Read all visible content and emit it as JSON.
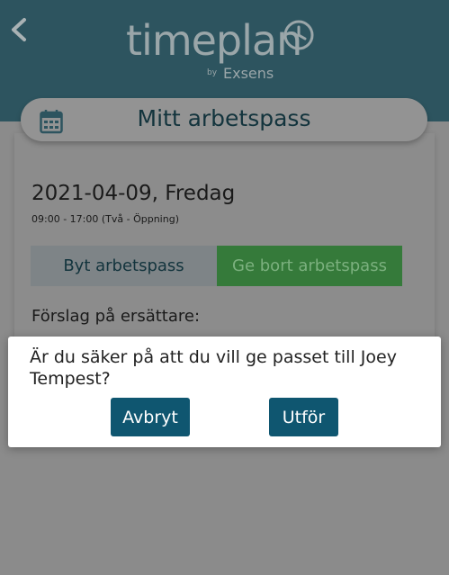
{
  "header": {
    "logo": {
      "word": "timeplan",
      "by": "by",
      "brand": "Exsens"
    }
  },
  "title": "Mitt arbetspass",
  "shift": {
    "date": "2021-04-09, Fredag",
    "time": "09:00 - 17:00 (Två - Öppning)"
  },
  "actions": {
    "swap_label": "Byt arbetspass",
    "give_away_label": "Ge bort arbetspass"
  },
  "proposal_label": "Förslag på ersättare:",
  "dialog": {
    "message": "Är du säker på att du vill ge passet till Joey Tempest?",
    "cancel_label": "Avbryt",
    "confirm_label": "Utför"
  },
  "colors": {
    "header": "#2d545f",
    "overlay": "#8b8b8b",
    "accent_button": "#0f5670",
    "give_away": "#357a3a"
  },
  "icons": {
    "back": "chevron-left-icon",
    "calendar": "calendar-icon",
    "logo_clock": "clock-icon"
  }
}
